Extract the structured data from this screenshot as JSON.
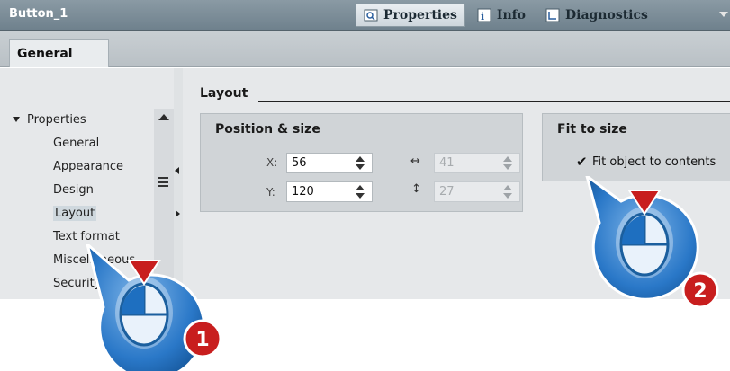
{
  "window": {
    "object_name": "Button_1"
  },
  "panel_tabs": [
    {
      "label": "Properties",
      "icon": "properties-icon",
      "active": true
    },
    {
      "label": "Info",
      "icon": "info-icon",
      "active": false
    },
    {
      "label": "Diagnostics",
      "icon": "diagnostics-icon",
      "active": false
    }
  ],
  "sub_tabs": {
    "general": "General"
  },
  "tree": {
    "root": "Properties",
    "items": [
      "General",
      "Appearance",
      "Design",
      "Layout",
      "Text format",
      "Miscellaneous",
      "Security"
    ],
    "selected": "Layout"
  },
  "section": {
    "title": "Layout"
  },
  "position_size": {
    "title": "Position & size",
    "x_label": "X:",
    "x_value": "56",
    "y_label": "Y:",
    "y_value": "120",
    "width_value": "41",
    "height_value": "27"
  },
  "fit_to_size": {
    "title": "Fit to size",
    "checkbox_label": "Fit object to contents",
    "checked": true
  },
  "callouts": {
    "step1": "1",
    "step2": "2"
  },
  "colors": {
    "callout_blue": "#1e6fc0",
    "callout_red": "#c81e1e",
    "header_gray": "#7d8e99"
  }
}
